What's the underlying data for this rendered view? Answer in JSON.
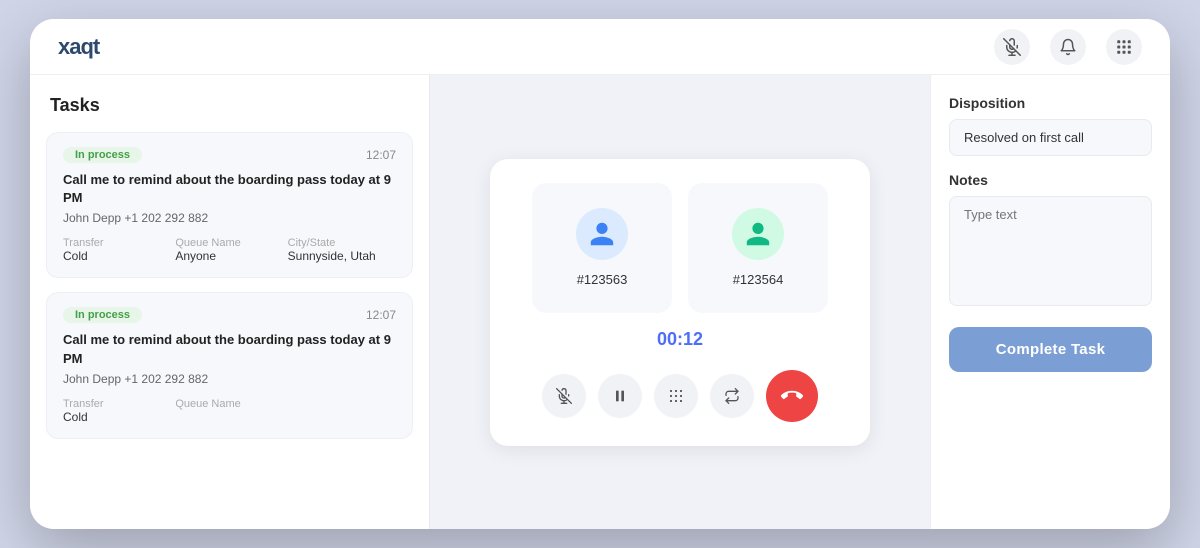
{
  "logo": "xaqt",
  "topbar": {
    "icons": [
      "mic-mute-icon",
      "bell-icon",
      "grid-icon"
    ]
  },
  "sidebar": {
    "title": "Tasks",
    "tasks": [
      {
        "badge": "In process",
        "time": "12:07",
        "title": "Call me to remind about the boarding pass today at 9 PM",
        "contact": "John Depp  +1 202 292 882",
        "meta": [
          {
            "label": "Transfer",
            "value": "Cold"
          },
          {
            "label": "Queue Name",
            "value": "Anyone"
          },
          {
            "label": "City/State",
            "value": "Sunnyside, Utah"
          }
        ]
      },
      {
        "badge": "In process",
        "time": "12:07",
        "title": "Call me to remind about the boarding pass today at 9 PM",
        "contact": "John Depp  +1 202 292 882",
        "meta": [
          {
            "label": "Transfer",
            "value": "Cold"
          },
          {
            "label": "Queue Name",
            "value": ""
          }
        ]
      }
    ]
  },
  "call": {
    "caller1_id": "#123563",
    "caller2_id": "#123564",
    "timer": "00:12"
  },
  "disposition": {
    "label": "Disposition",
    "value": "Resolved on first call"
  },
  "notes": {
    "label": "Notes",
    "placeholder": "Type text"
  },
  "complete_button": "Complete Task"
}
